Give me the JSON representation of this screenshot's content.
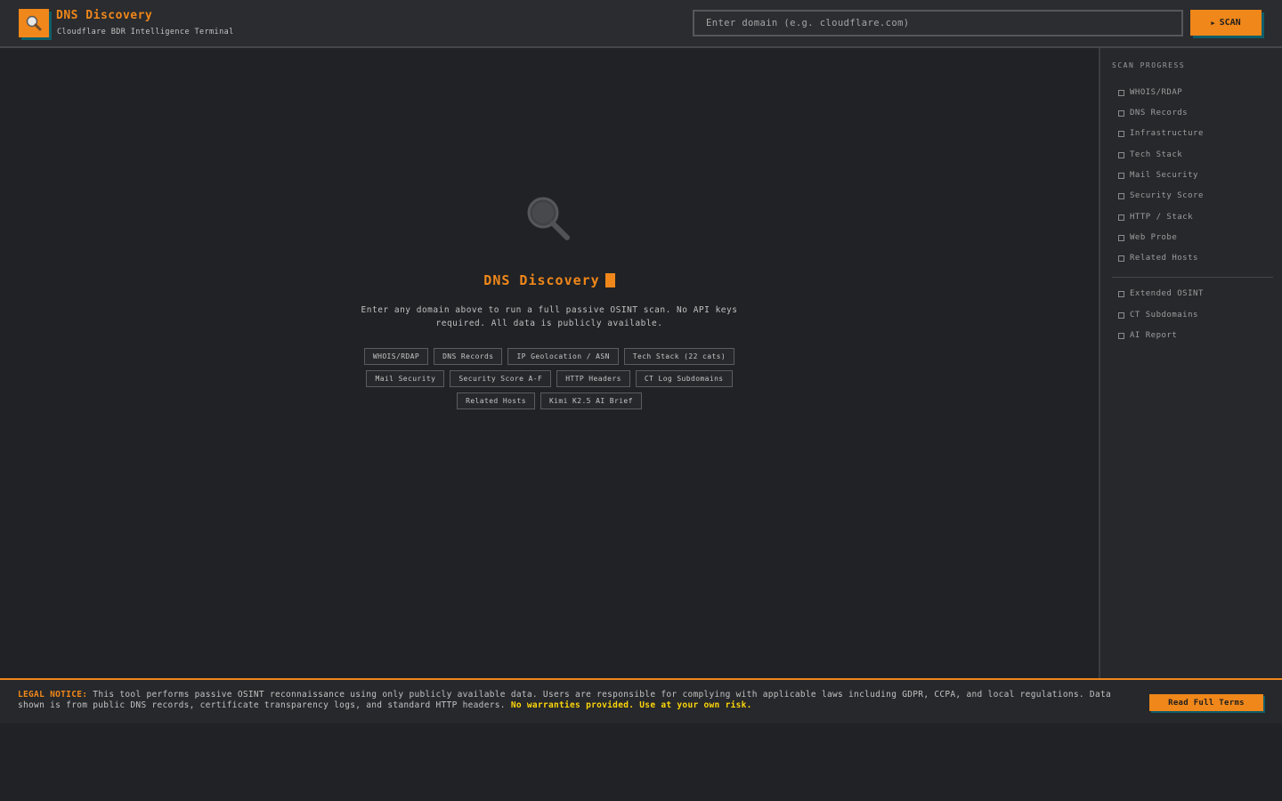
{
  "header": {
    "title": "DNS Discovery",
    "subtitle": "Cloudflare BDR Intelligence Terminal",
    "logo_icon": "magnifier-icon",
    "search_placeholder": "Enter domain (e.g. cloudflare.com)",
    "search_value": "",
    "scan_label": "SCAN"
  },
  "hero": {
    "icon": "magnifier-icon",
    "title": "DNS Discovery",
    "description": "Enter any domain above to run a full passive OSINT scan. No API keys required. All data is publicly available.",
    "chips": [
      "WHOIS/RDAP",
      "DNS Records",
      "IP Geolocation / ASN",
      "Tech Stack (22 cats)",
      "Mail Security",
      "Security Score A-F",
      "HTTP Headers",
      "CT Log Subdomains",
      "Related Hosts",
      "Kimi K2.5 AI Brief"
    ]
  },
  "sidebar": {
    "heading": "SCAN PROGRESS",
    "steps": [
      "WHOIS/RDAP",
      "DNS Records",
      "Infrastructure",
      "Tech Stack",
      "Mail Security",
      "Security Score",
      "HTTP / Stack",
      "Web Probe",
      "Related Hosts"
    ],
    "extended_steps": [
      "Extended OSINT",
      "CT Subdomains",
      "AI Report"
    ]
  },
  "legal": {
    "label": "LEGAL NOTICE:",
    "text": "This tool performs passive OSINT reconnaissance using only publicly available data. Users are responsible for complying with applicable laws including GDPR, CCPA, and local regulations. Data shown is from public DNS records, certificate transparency logs, and standard HTTP headers.",
    "warning": "No warranties provided. Use at your own risk.",
    "terms_button": "Read Full Terms"
  },
  "colors": {
    "accent": "#f0871a",
    "accent_shadow": "#0e5e69",
    "warning": "#ffd60a",
    "background": "#202225"
  }
}
